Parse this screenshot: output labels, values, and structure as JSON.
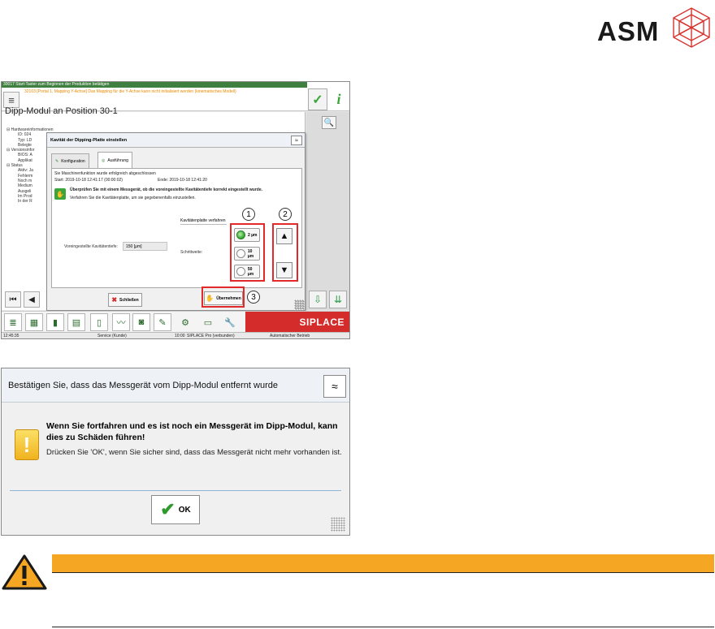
{
  "logo": {
    "text": "ASM"
  },
  "screen1": {
    "header": {
      "alert_line": "30017 Start-Taster zum Beginnen der Produktion betätigen",
      "message": "32103 [Portal 1, Mapping Y-Achse] Das Mapping für die Y-Achse kann nicht initialisiert werden (kinematisches Modell)",
      "menu_glyph": "≡",
      "confirm_glyph": "✓",
      "info_glyph": "i"
    },
    "page_title": "Dipp-Modul an Position 30-1",
    "tree": [
      "⊟  Hardwareinformationen",
      "ID: 024",
      "Typ: LD",
      "Belegte",
      "⊟  Versionsinfor",
      "BIOS: A",
      "Applikat",
      "⊟  Status",
      "Aktiv: Ja",
      "Fehlerm",
      "Noch m",
      "Medium",
      "Ausgeli",
      "Im Prod",
      "In der R"
    ],
    "dialog": {
      "title": "Kavität der Dipping-Platte einstellen",
      "collapse_glyph": "≈",
      "tabs": [
        {
          "label": "Konfiguration"
        },
        {
          "label": "Ausführung"
        }
      ],
      "status": "Sie Maschinenfunktion wurde erfolgreich abgeschlossen",
      "time_start": "Start: 2019-10-18 12:41:17 (00:00:02)",
      "time_end": "Ende: 2019-10-18 12:41:20",
      "instruction_bold": "Überprüfen Sie mit einem Messgerät, ob die voreingestellte Kavitätentiefe korrekt eingestellt wurde.",
      "instruction": "Verfahren Sie die Kavitätenplatte, um sie gegebenenfalls einzustellen.",
      "move_label": "Kavitätenplatte verfahren",
      "preset_label": "Voreingestellte Kavitätentiefe:",
      "preset_value": "150 [µm]",
      "step_label": "Schrittweite:",
      "steps": [
        {
          "label": "2 µm",
          "selected": true
        },
        {
          "label": "10 µm",
          "selected": false
        },
        {
          "label": "50 µm",
          "selected": false
        }
      ],
      "up_glyph": "▲",
      "down_glyph": "▼",
      "close_label": "Schließen",
      "apply_label": "Übernehmen",
      "callouts": [
        "1",
        "2",
        "3"
      ]
    },
    "nav": {
      "first_glyph": "⏮",
      "prev_glyph": "◀"
    },
    "toolbar": {
      "icons": [
        "stack-icon",
        "grid-icon",
        "bar-chart-icon",
        "table-icon",
        "clipboard-icon",
        "line-chart-icon",
        "camera-icon",
        "pen-icon",
        "gears-icon",
        "truck-icon",
        "wrench-icon"
      ],
      "brand": "SIPLACE"
    },
    "status_bar": {
      "time": "12:45:35",
      "user": "Service (Kunde)",
      "clock": "10:00",
      "connection": "SIPLACE Pro (verbunden)",
      "mode": "Automatischer Betrieb"
    }
  },
  "screen2": {
    "title": "Bestätigen Sie, dass das Messgerät vom Dipp-Modul entfernt wurde",
    "collapse_glyph": "≈",
    "warning_glyph": "!",
    "bold_text": "Wenn Sie fortfahren und es ist noch ein Messgerät im Dipp-Modul, kann dies zu Schäden führen!",
    "text": "Drücken Sie 'OK', wenn Sie sicher sind, dass das Messgerät nicht mehr vorhanden ist.",
    "ok_label": "OK"
  },
  "warning": {
    "title": "",
    "color": "#f5a623"
  }
}
